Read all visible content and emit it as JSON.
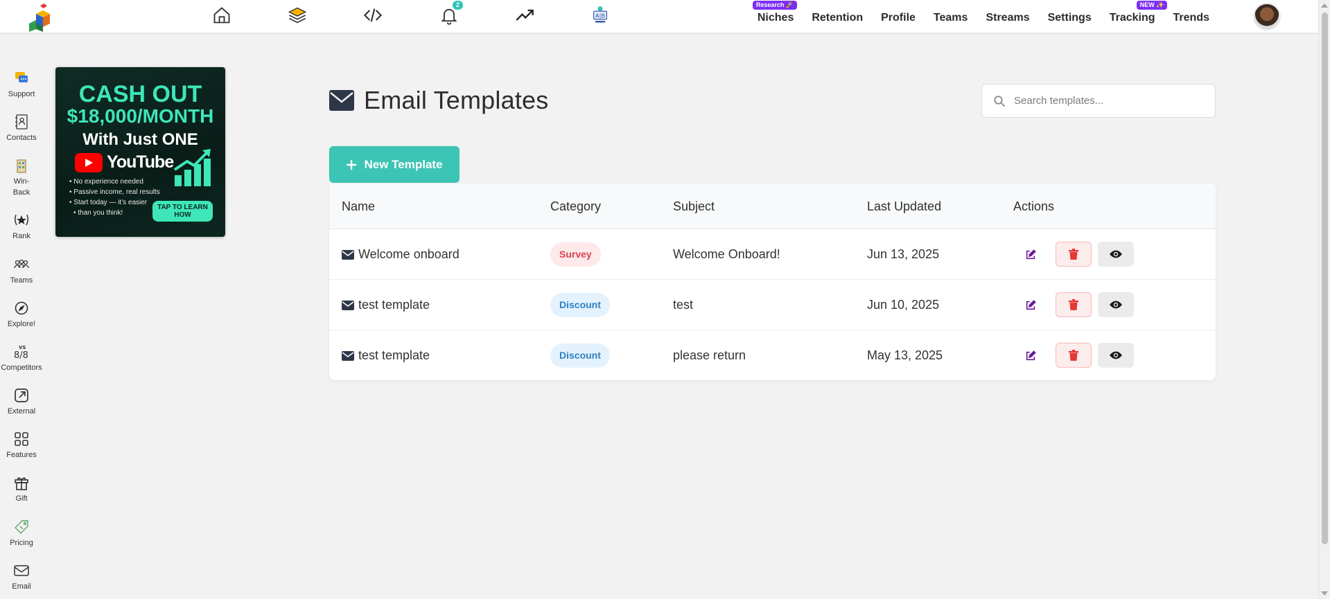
{
  "header": {
    "nav_icons": [
      "home-icon",
      "layers-icon",
      "code-icon",
      "bell-icon",
      "trending-up-icon",
      "ab-test-icon"
    ],
    "notification_count": "2",
    "menu": [
      {
        "label": "Niches",
        "badge": "Research 🚀"
      },
      {
        "label": "Retention",
        "badge": ""
      },
      {
        "label": "Profile",
        "badge": ""
      },
      {
        "label": "Teams",
        "badge": ""
      },
      {
        "label": "Streams",
        "badge": ""
      },
      {
        "label": "Settings",
        "badge": ""
      },
      {
        "label": "Tracking",
        "badge": "NEW ✨"
      },
      {
        "label": "Trends",
        "badge": ""
      }
    ]
  },
  "sidebar": {
    "items": [
      {
        "label": "Support",
        "icon": "support-chat-icon"
      },
      {
        "label": "Contacts",
        "icon": "contacts-book-icon"
      },
      {
        "label": "Win-\nBack",
        "icon": "win-back-icon"
      },
      {
        "label": "Rank",
        "icon": "rank-star-icon"
      },
      {
        "label": "Teams",
        "icon": "teams-icon"
      },
      {
        "label": "Explore!",
        "icon": "compass-icon"
      },
      {
        "label": "Competitors",
        "icon": "versus-icon"
      },
      {
        "label": "External",
        "icon": "external-link-icon"
      },
      {
        "label": "Features",
        "icon": "grid-icon"
      },
      {
        "label": "Gift",
        "icon": "gift-icon"
      },
      {
        "label": "Pricing",
        "icon": "price-tag-icon"
      },
      {
        "label": "Email",
        "icon": "envelope-icon"
      }
    ]
  },
  "ad": {
    "line1": "CASH OUT",
    "line2": "$18,000/MONTH",
    "line3": "With Just ONE",
    "brand": "YouTube",
    "bullets": [
      "No experience needed",
      "Passive income, real results",
      "Start today — it's easier",
      "than you think!"
    ],
    "cta": "TAP TO LEARN HOW"
  },
  "main": {
    "title": "Email Templates",
    "search_placeholder": "Search templates...",
    "new_button_label": "New Template",
    "columns": [
      "Name",
      "Category",
      "Subject",
      "Last Updated",
      "Actions"
    ],
    "rows": [
      {
        "name": "Welcome onboard",
        "category": "Survey",
        "subject": "Welcome Onboard!",
        "updated": "Jun 13, 2025"
      },
      {
        "name": "test template",
        "category": "Discount",
        "subject": "test",
        "updated": "Jun 10, 2025"
      },
      {
        "name": "test template",
        "category": "Discount",
        "subject": "please return",
        "updated": "May 13, 2025"
      }
    ]
  },
  "colors": {
    "accent": "#3cc4b4",
    "edit_icon": "#6a1b9a",
    "delete_icon": "#e53935",
    "survey_badge": "#d9434f",
    "discount_badge": "#2d7fc1",
    "menu_badge": "#7b2ff7"
  }
}
